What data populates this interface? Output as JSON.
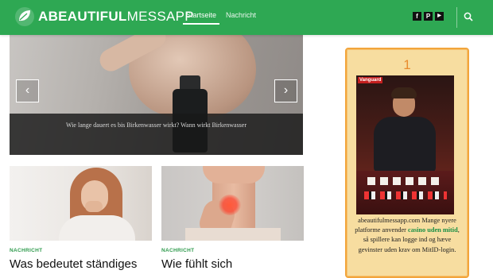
{
  "header": {
    "logo_bold": "ABEAUTIFUL",
    "logo_light": "MESSAPP",
    "nav": [
      "Startseite",
      "Nachricht"
    ],
    "social": [
      {
        "icon": "facebook-icon",
        "glyph": "f"
      },
      {
        "icon": "pinterest-icon",
        "glyph": "P"
      },
      {
        "icon": "youtube-icon",
        "glyph": "▶"
      }
    ]
  },
  "slider": {
    "caption": "Wie lange dauert es bis Birkenwasser wirkt? Wann wirkt Birkenwasser",
    "prev": "‹",
    "next": "›"
  },
  "cards": [
    {
      "category": "NACHRICHT",
      "title": "Was bedeutet ständiges"
    },
    {
      "category": "NACHRICHT",
      "title": "Wie fühlt sich"
    }
  ],
  "ad": {
    "number": "1",
    "badge": "Vanguard",
    "text_before": "abeautifulmessapp.com Mange nyere platforme anvender ",
    "link": "casino uden mitid",
    "text_after": ", så spillere kan logge ind og hæve gevinster uden krav om MitID-login."
  },
  "colors": {
    "brand": "#2ea853",
    "accent": "#f2a53c",
    "link": "#1a8f46"
  }
}
